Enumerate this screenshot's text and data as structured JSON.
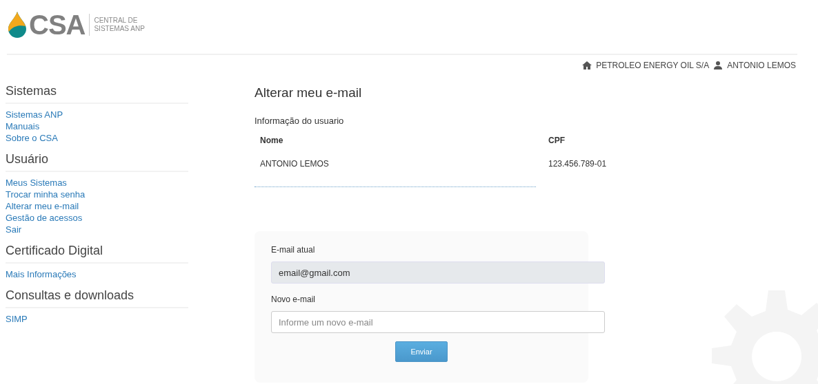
{
  "logo": {
    "mark": "CSA",
    "tagline_1": "CENTRAL DE",
    "tagline_2": "SISTEMAS ANP"
  },
  "user_bar": {
    "company": "PETROLEO ENERGY OIL S/A",
    "user": "ANTONIO LEMOS"
  },
  "sidebar": {
    "sections": [
      {
        "title": "Sistemas",
        "items": [
          "Sistemas ANP",
          "Manuais",
          "Sobre o CSA"
        ]
      },
      {
        "title": "Usuário",
        "items": [
          "Meus Sistemas",
          "Trocar minha senha",
          "Alterar meu e-mail",
          "Gestão de acessos",
          "Sair"
        ]
      },
      {
        "title": "Certificado Digital",
        "items": [
          "Mais Informações"
        ]
      },
      {
        "title": "Consultas e downloads",
        "items": [
          "SIMP"
        ]
      }
    ]
  },
  "page_title": "Alterar meu e-mail",
  "user_info": {
    "title": "Informação do usuario",
    "columns": [
      "Nome",
      "CPF"
    ],
    "values": [
      "ANTONIO LEMOS",
      "123.456.789-01"
    ]
  },
  "form": {
    "current_label": "E-mail atual",
    "current_value": "email@gmail.com",
    "new_label": "Novo e-mail",
    "new_placeholder": "Informe um novo e-mail",
    "submit": "Enviar"
  }
}
